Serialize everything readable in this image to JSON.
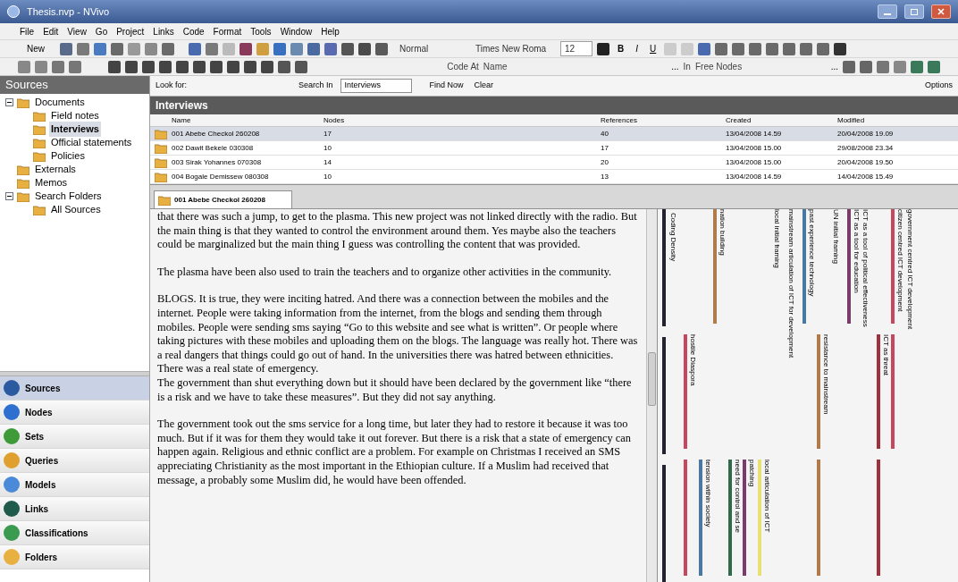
{
  "window": {
    "title": "Thesis.nvp - NVivo"
  },
  "menu": [
    "File",
    "Edit",
    "View",
    "Go",
    "Project",
    "Links",
    "Code",
    "Format",
    "Tools",
    "Window",
    "Help"
  ],
  "toolbar": {
    "new": "New",
    "style": "Normal",
    "font": "Times New Roma",
    "size": "12",
    "bold": "B",
    "italic": "I",
    "underline": "U"
  },
  "coding_bar": {
    "code_at": "Code At",
    "name": "Name",
    "more": "...",
    "in": "In",
    "location": "Free Nodes",
    "more2": "..."
  },
  "sidebar": {
    "title": "Sources",
    "tree": [
      {
        "label": "Documents",
        "expanded": true,
        "selected": false,
        "children": [
          {
            "label": "Field notes",
            "selected": false
          },
          {
            "label": "Interviews",
            "selected": true
          },
          {
            "label": "Official statements",
            "selected": false
          },
          {
            "label": "Policies",
            "selected": false
          }
        ]
      },
      {
        "label": "Externals",
        "selected": false
      },
      {
        "label": "Memos",
        "selected": false
      },
      {
        "label": "Search Folders",
        "expanded": true,
        "selected": false,
        "children": [
          {
            "label": "All Sources",
            "selected": false
          }
        ]
      }
    ],
    "nav": [
      {
        "label": "Sources",
        "selected": true,
        "color": "#2c5aa0"
      },
      {
        "label": "Nodes",
        "selected": false,
        "color": "#2f6fd0"
      },
      {
        "label": "Sets",
        "selected": false,
        "color": "#3f9a3a"
      },
      {
        "label": "Queries",
        "selected": false,
        "color": "#e0a030"
      },
      {
        "label": "Models",
        "selected": false,
        "color": "#4a8ad8"
      },
      {
        "label": "Links",
        "selected": false,
        "color": "#1f5a4a"
      },
      {
        "label": "Classifications",
        "selected": false,
        "color": "#3a9a50"
      },
      {
        "label": "Folders",
        "selected": false,
        "color": "#e8b040"
      }
    ]
  },
  "find_bar": {
    "look_for": "Look for:",
    "search_in": "Search In",
    "scope": "Interviews",
    "find_now": "Find Now",
    "clear": "Clear",
    "options": "Options"
  },
  "table": {
    "title": "Interviews",
    "columns": [
      "Name",
      "Nodes",
      "References",
      "Created",
      "Modified"
    ],
    "rows": [
      {
        "selected": true,
        "cells": [
          "001 Abebe Checkol 260208",
          "17",
          "40",
          "13/04/2008 14.59",
          "20/04/2008 19.09"
        ]
      },
      {
        "selected": false,
        "cells": [
          "002 Dawit Bekele 030308",
          "10",
          "17",
          "13/04/2008 15.00",
          "29/08/2008 23.34"
        ]
      },
      {
        "selected": false,
        "cells": [
          "003 Sirak Yohannes 070308",
          "14",
          "20",
          "13/04/2008 15.00",
          "20/04/2008 19.50"
        ]
      },
      {
        "selected": false,
        "cells": [
          "004 Bogale Demissew 080308",
          "10",
          "13",
          "13/04/2008 14.59",
          "14/04/2008 15.49"
        ]
      }
    ]
  },
  "document_tab": {
    "label": "001 Abebe Checkol 260208"
  },
  "document": [
    "that there was such a jump, to get to the plasma. This new project was not linked directly with the radio. But the main thing is that they wanted to control the environment around them. Yes maybe also the teachers could be marginalized but the main thing I guess was controlling the content that was provided.",
    "The plasma have been also used to train the teachers and to organize other activities in the community.",
    "BLOGS. It is true, they were inciting hatred. And there was a connection between the mobiles and the internet. People were taking information from the internet, from the blogs and sending them through mobiles. People were sending sms saying “Go to this website and see what is written”. Or people where taking pictures with these mobiles and uploading them on the blogs. The language was really hot. There was a real dangers that things could go out of hand. In the universities there was hatred between ethnicities. There was a real state of emergency.\nThe government than shut everything down but it should have been declared by the government like “there is a risk and we have to take these measures”. But they did not say anything.",
    "The government took out the sms service for a long time, but later they had to restore it because it was too much. But if it was for them they would take it out forever. But there is a risk that a state of emergency can happen again. Religious and ethnic conflict are a problem. For example on Christmas I received an SMS appreciating Christianity as the most important in the Ethiopian culture. If a Muslim had received that message, a probably some Muslim did, he would have been offended."
  ],
  "coding_stripes": {
    "density_label": "Coding Density",
    "columns": [
      {
        "middle": {
          "color": "#c8465e",
          "label": "hostile Diaspora"
        },
        "bottom": {
          "color": "#c8465e"
        }
      },
      {
        "bottom": {
          "color": "#4a78a0",
          "label": "tension within society"
        }
      },
      {
        "top": {
          "color": "#b07a4a",
          "label": "nation building"
        }
      },
      {
        "bottom": {
          "color": "#2f6a4a",
          "label": "need for control and se"
        }
      },
      {
        "bottom": {
          "color": "#7a3a6a",
          "label": "patching"
        }
      },
      {
        "bottom": {
          "color": "#e8e070",
          "label": "local articulation of ICT"
        }
      },
      {
        "top": {
          "label": "local initial framing"
        }
      },
      {
        "top": {
          "label": "mainstream articulation of ICT for development"
        }
      },
      {
        "top": {
          "color": "#4a78a0",
          "label": "past experience technology"
        }
      },
      {
        "middle": {
          "color": "#b07a4a",
          "label": "resistance to mainstream"
        },
        "bottom": {
          "color": "#b07a4a"
        }
      },
      {
        "top": {
          "label": "UN initial framing"
        }
      },
      {
        "top": {
          "color": "#7a3a6a",
          "label": "ICT as a tool for education"
        }
      },
      {
        "top": {
          "label": "ICT as a tool of political effectiveness"
        }
      },
      {
        "middle": {
          "color": "#a0303e",
          "label": "ICT as threat"
        },
        "bottom": {
          "color": "#a0303e"
        }
      },
      {
        "top": {
          "color": "#c8465e",
          "label": "citizen centred ICT development"
        },
        "middle": {
          "color": "#c8465e"
        }
      },
      {
        "top": {
          "label": "government centred ICT development"
        }
      }
    ]
  }
}
